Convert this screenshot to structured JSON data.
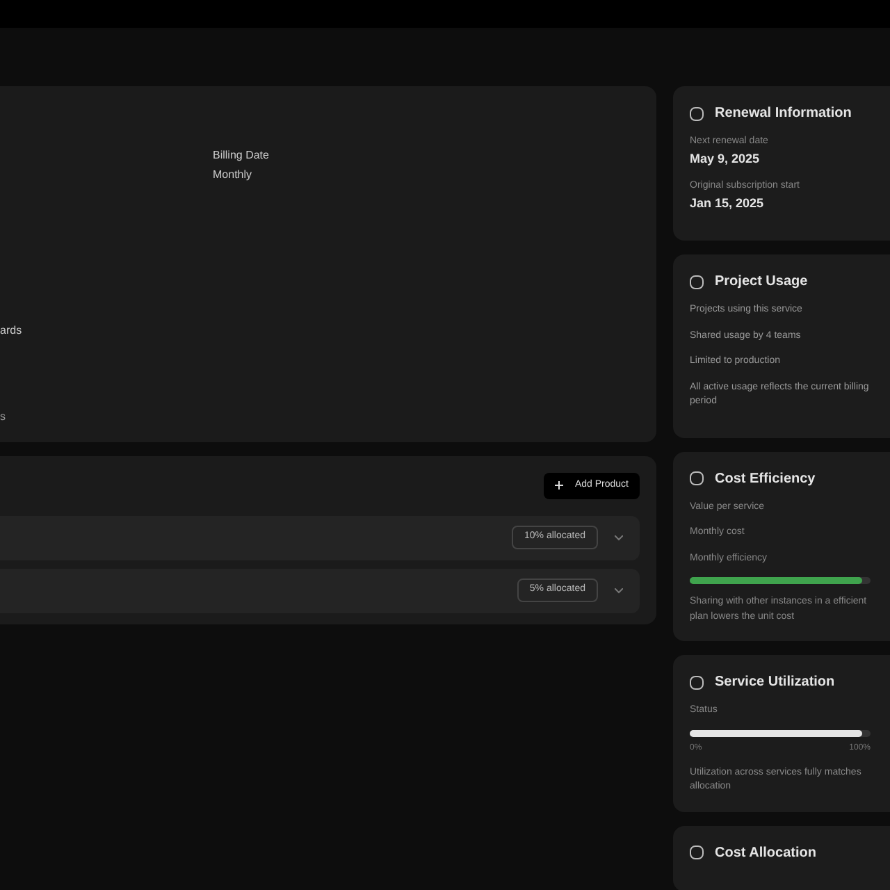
{
  "details_card": {
    "billing_label": "Billing Date",
    "billing_value": "Monthly",
    "edge_text_1": "ards",
    "edge_text_2": "s"
  },
  "products_card": {
    "add_button": "Add Product",
    "rows": [
      {
        "badge": "10% allocated"
      },
      {
        "badge": "5% allocated"
      }
    ]
  },
  "side_cards": [
    {
      "kind": "info",
      "title": "Renewal Information",
      "lines": [
        {
          "label": "Next renewal date",
          "value": "May 9, 2025"
        },
        {
          "label": "Original subscription start",
          "value": "Jan 15, 2025"
        }
      ]
    },
    {
      "kind": "notes",
      "title": "Project Usage",
      "lines": [
        "Projects using this service",
        "Shared usage by 4 teams",
        "Limited to production",
        "All active usage reflects the current billing period"
      ]
    },
    {
      "kind": "meter",
      "title": "Cost Efficiency",
      "lines": [
        "Value per service",
        "Monthly cost",
        "Monthly efficiency"
      ],
      "level": 0.95,
      "color": "#3fa34d",
      "note": "Sharing with other instances in a efficient plan lowers the unit cost"
    },
    {
      "kind": "meter",
      "title": "Service Utilization",
      "lines": [
        "Status"
      ],
      "level": 0.95,
      "color": "#e5e5e5",
      "scale": [
        "0%",
        "100%"
      ],
      "note": "Utilization across services fully matches allocation"
    },
    {
      "kind": "title",
      "title": "Cost Allocation"
    }
  ]
}
